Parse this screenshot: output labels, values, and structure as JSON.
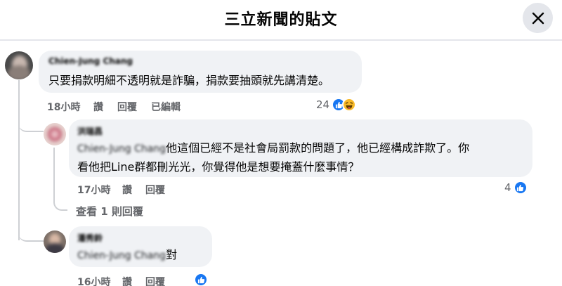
{
  "header": {
    "title": "三立新聞的貼文"
  },
  "comments": [
    {
      "author": "Chien-Jung Chang",
      "text": "只要捐款明細不透明就是詐騙，捐款要抽頭就先講清楚。",
      "time": "18小時",
      "like_label": "讚",
      "reply_label": "回覆",
      "edited_label": "已編輯",
      "reaction_count": "24",
      "reactions": [
        "like-icon",
        "haha-icon"
      ]
    },
    {
      "author": "洪瑞昌",
      "mention": "Chien-Jung Chang",
      "text_line1": "他這個已經不是社會局罰款的問題了，他已經構成詐欺了。你",
      "text_line2": "看他把Line群都刪光光，你覺得他是想要掩蓋什麼事情？",
      "time": "17小時",
      "like_label": "讚",
      "reply_label": "回覆",
      "reaction_count": "4",
      "reactions": [
        "like-icon"
      ]
    },
    {
      "author": "潘秀鈴",
      "mention": "Chien-Jung Chang",
      "text": "對",
      "time": "16小時",
      "like_label": "讚",
      "reply_label": "回覆",
      "reactions": [
        "like-icon"
      ]
    }
  ],
  "view_replies": "查看 1 則回覆",
  "colors": {
    "like": "#1877f2",
    "haha": "#f7b928",
    "bubble": "#f0f2f5",
    "meta": "#65676b"
  }
}
